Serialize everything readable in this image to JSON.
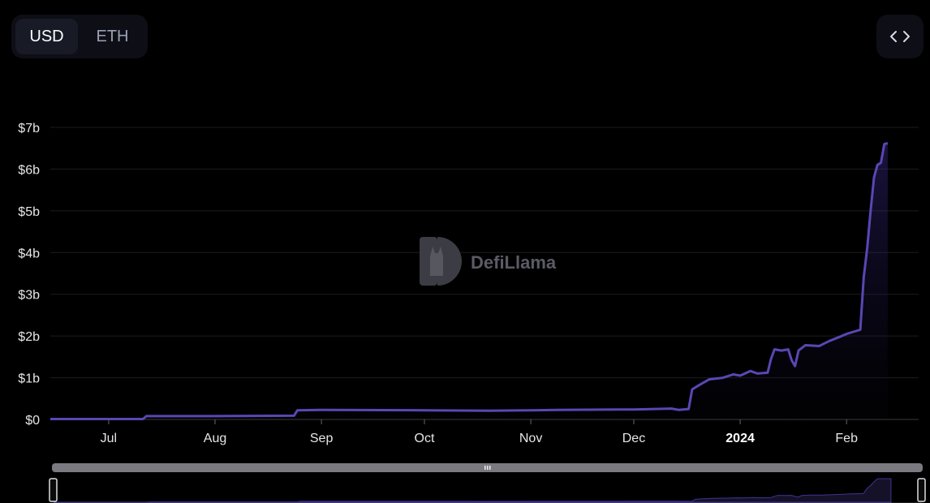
{
  "currency_toggle": {
    "options": [
      "USD",
      "ETH"
    ],
    "selected": "USD"
  },
  "embed_icon": "code-icon",
  "watermark": {
    "text": "DefiLlama"
  },
  "colors": {
    "line": "#5b46b4",
    "background": "#000000"
  },
  "chart_data": {
    "type": "area",
    "title": "",
    "xlabel": "",
    "ylabel": "",
    "ylim": [
      0,
      7
    ],
    "y_ticks": [
      {
        "value": 0,
        "label": "$0"
      },
      {
        "value": 1,
        "label": "$1b"
      },
      {
        "value": 2,
        "label": "$2b"
      },
      {
        "value": 3,
        "label": "$3b"
      },
      {
        "value": 4,
        "label": "$4b"
      },
      {
        "value": 5,
        "label": "$5b"
      },
      {
        "value": 6,
        "label": "$6b"
      },
      {
        "value": 7,
        "label": "$7b"
      }
    ],
    "xlim": [
      "2023-06-14",
      "2024-02-22"
    ],
    "x_ticks": [
      {
        "date": "2023-07-01",
        "label": "Jul"
      },
      {
        "date": "2023-08-01",
        "label": "Aug"
      },
      {
        "date": "2023-09-01",
        "label": "Sep"
      },
      {
        "date": "2023-10-01",
        "label": "Oct"
      },
      {
        "date": "2023-11-01",
        "label": "Nov"
      },
      {
        "date": "2023-12-01",
        "label": "Dec"
      },
      {
        "date": "2024-01-01",
        "label": "2024",
        "bold": true
      },
      {
        "date": "2024-02-01",
        "label": "Feb"
      }
    ],
    "grid": true,
    "series": [
      {
        "points": [
          [
            "2023-06-14",
            0.01
          ],
          [
            "2023-07-11",
            0.01
          ],
          [
            "2023-07-12",
            0.08
          ],
          [
            "2023-08-01",
            0.08
          ],
          [
            "2023-08-24",
            0.09
          ],
          [
            "2023-08-25",
            0.22
          ],
          [
            "2023-09-01",
            0.23
          ],
          [
            "2023-10-01",
            0.22
          ],
          [
            "2023-10-20",
            0.21
          ],
          [
            "2023-11-01",
            0.22
          ],
          [
            "2023-11-09",
            0.23
          ],
          [
            "2023-12-01",
            0.24
          ],
          [
            "2023-12-12",
            0.26
          ],
          [
            "2023-12-14",
            0.23
          ],
          [
            "2023-12-17",
            0.25
          ],
          [
            "2023-12-18",
            0.72
          ],
          [
            "2023-12-20",
            0.82
          ],
          [
            "2023-12-23",
            0.96
          ],
          [
            "2023-12-27",
            1.0
          ],
          [
            "2023-12-30",
            1.08
          ],
          [
            "2024-01-01",
            1.05
          ],
          [
            "2024-01-04",
            1.16
          ],
          [
            "2024-01-06",
            1.1
          ],
          [
            "2024-01-09",
            1.12
          ],
          [
            "2024-01-10",
            1.45
          ],
          [
            "2024-01-11",
            1.68
          ],
          [
            "2024-01-13",
            1.65
          ],
          [
            "2024-01-15",
            1.68
          ],
          [
            "2024-01-16",
            1.42
          ],
          [
            "2024-01-17",
            1.28
          ],
          [
            "2024-01-18",
            1.65
          ],
          [
            "2024-01-20",
            1.78
          ],
          [
            "2024-01-24",
            1.76
          ],
          [
            "2024-01-27",
            1.88
          ],
          [
            "2024-01-30",
            1.98
          ],
          [
            "2024-02-01",
            2.05
          ],
          [
            "2024-02-03",
            2.1
          ],
          [
            "2024-02-05",
            2.15
          ],
          [
            "2024-02-06",
            3.4
          ],
          [
            "2024-02-07",
            4.1
          ],
          [
            "2024-02-08",
            5.0
          ],
          [
            "2024-02-09",
            5.8
          ],
          [
            "2024-02-10",
            6.1
          ],
          [
            "2024-02-11",
            6.15
          ],
          [
            "2024-02-12",
            6.6
          ],
          [
            "2024-02-13",
            6.62
          ]
        ]
      }
    ],
    "legend": "none"
  }
}
